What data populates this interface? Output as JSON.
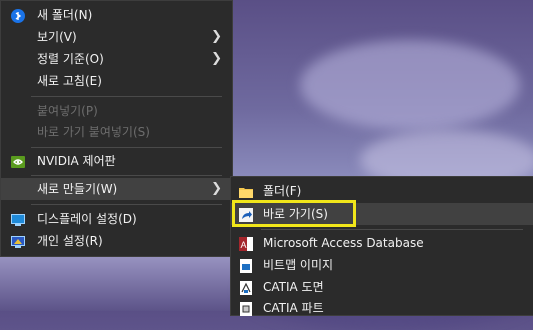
{
  "context_menu": {
    "items": [
      {
        "label": "새 폴더(N)"
      },
      {
        "label": "보기(V)"
      },
      {
        "label": "정렬 기준(O)"
      },
      {
        "label": "새로 고침(E)"
      },
      {
        "label": "붙여넣기(P)"
      },
      {
        "label": "바로 가기 붙여넣기(S)"
      },
      {
        "label": "NVIDIA 제어판"
      },
      {
        "label": "새로 만들기(W)"
      },
      {
        "label": "디스플레이 설정(D)"
      },
      {
        "label": "개인 설정(R)"
      }
    ]
  },
  "submenu": {
    "items": [
      {
        "label": "폴더(F)"
      },
      {
        "label": "바로 가기(S)"
      },
      {
        "label": "Microsoft Access Database"
      },
      {
        "label": "비트맵 이미지"
      },
      {
        "label": "CATIA 도면"
      },
      {
        "label": "CATIA 파트"
      }
    ]
  },
  "colors": {
    "menu_bg": "#2b2b2b",
    "hover_bg": "#414141",
    "highlight_border": "#f1e61a"
  }
}
